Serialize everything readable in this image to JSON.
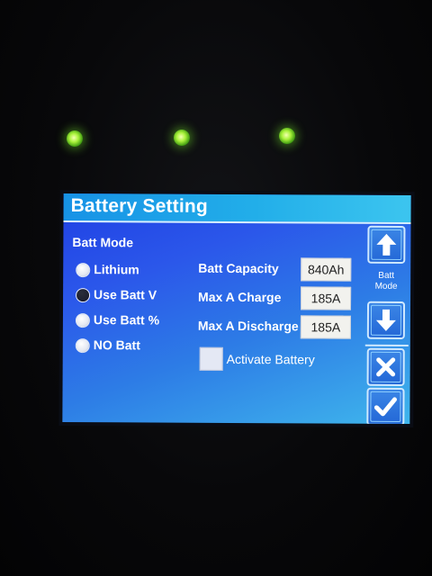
{
  "screen": {
    "title": "Battery Setting",
    "batt_mode_heading": "Batt Mode",
    "batt_mode_options": [
      {
        "label": "Lithium",
        "selected": false
      },
      {
        "label": "Use Batt V",
        "selected": true
      },
      {
        "label": "Use Batt %",
        "selected": false
      },
      {
        "label": "NO Batt",
        "selected": false
      }
    ],
    "settings": [
      {
        "label": "Batt Capacity",
        "value": "840Ah"
      },
      {
        "label": "Max A Charge",
        "value": "185A"
      },
      {
        "label": "Max A Discharge",
        "value": "185A"
      }
    ],
    "activate_battery_label": "Activate Battery",
    "activate_battery_checked": false,
    "side_panel": {
      "mode_caption_line1": "Batt",
      "mode_caption_line2": "Mode",
      "up_icon": "up-arrow-icon",
      "down_icon": "down-arrow-icon",
      "cancel_icon": "x-icon",
      "confirm_icon": "checkmark-icon"
    }
  },
  "colors": {
    "led": "#9af03a",
    "panel_blue": "#2b57ea",
    "title_bar": "#22aee9"
  }
}
